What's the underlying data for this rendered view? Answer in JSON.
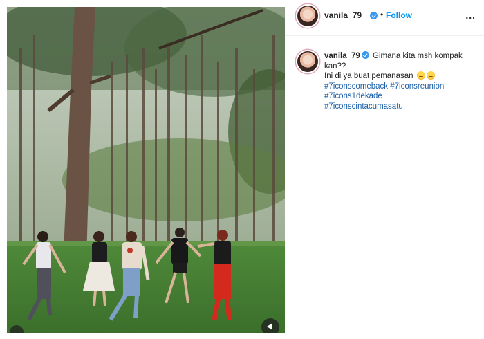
{
  "post": {
    "media": {
      "type": "video",
      "description_icon": "video-mute-icon"
    },
    "header": {
      "username": "vanila_79",
      "dot": "•",
      "follow_label": "Follow",
      "more_label": "..."
    },
    "caption": {
      "username": "vanila_79",
      "line1": "Gimana kita msh kompak kan??",
      "line2": "Ini di ya buat pemanasan",
      "hashtags": [
        "#7iconscomeback",
        "#7iconsreunion",
        "#7icons1dekade",
        "#7iconscintacumasatu"
      ]
    },
    "colors": {
      "accent": "#0095f6",
      "verified": "#3897f0",
      "hashtag": "#1a5fa8"
    }
  }
}
